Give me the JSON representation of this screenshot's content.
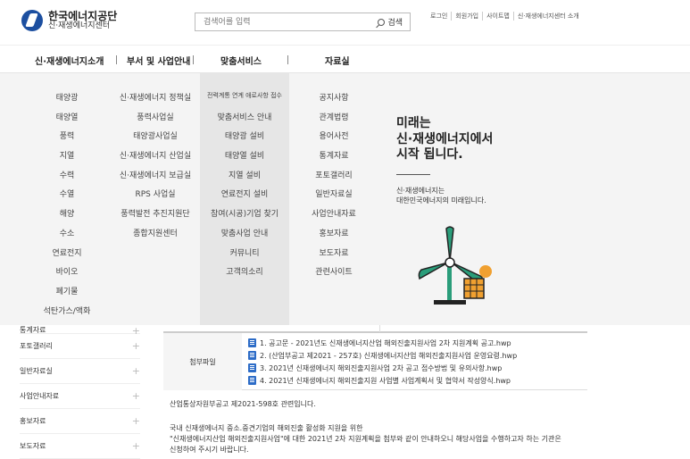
{
  "header": {
    "logo_name": "한국에너지공단",
    "logo_sub": "신·재생에너지센터",
    "search_placeholder": "검색어를 입력",
    "search_button": "검색",
    "util_links": [
      "로그인",
      "회원가입",
      "사이트맵",
      "신·재생에너지센터 소개"
    ]
  },
  "gnb": [
    "신·재생에너지소개",
    "부서 및 사업안내",
    "맞춤서비스",
    "자료실"
  ],
  "mega": {
    "col1": [
      "태양광",
      "태양열",
      "풍력",
      "지열",
      "수력",
      "수열",
      "해양",
      "수소",
      "연료전지",
      "바이오",
      "폐기물",
      "석탄가스/액화"
    ],
    "col2": [
      "신·재생에너지 정책실",
      "풍력사업실",
      "태양광사업실",
      "신·재생에너지 산업실",
      "신·재생에너지 보급실",
      "RPS 사업실",
      "풍력발전 추진지원단",
      "종합지원센터"
    ],
    "col3": [
      "전력계통 연계 애로사항 접수",
      "맞춤서비스 안내",
      "태양광 설비",
      "태양열 설비",
      "지열 설비",
      "연료전지 설비",
      "참여(시공)기업 찾기",
      "맞춤사업 안내",
      "커뮤니티",
      "고객의소리"
    ],
    "col4": [
      "공지사항",
      "관계법령",
      "용어사전",
      "통계자료",
      "포토갤러리",
      "일반자료실",
      "사업안내자료",
      "홍보자료",
      "보도자료",
      "관련사이트"
    ]
  },
  "promo": {
    "title1": "미래는",
    "title2": "신·재생에너지에서",
    "title3": "시작 됩니다.",
    "sub1": "신·재생에너지는",
    "sub2": "대한민국에너지의 미래입니다."
  },
  "lnb": [
    "통계자료",
    "포토갤러리",
    "일반자료실",
    "사업안내자료",
    "홍보자료",
    "보도자료"
  ],
  "attach": {
    "label": "첨부파일",
    "files": [
      "1. 공고문 - 2021년도 신재생에너지산업 해외진출지원사업 2차 지원계획 공고.hwp",
      "2. (산업부공고 제2021 - 257호) 신재생에너지산업 해외진출지원사업 운영요령.hwp",
      "3. 2021년 신재생에너지 해외진출지원사업 2차 공고 접수방법 및 유의사항.hwp",
      "4. 2021년 신재생에너지 해외진출지원 사업별 사업계획서 및 협약서 작성양식.hwp"
    ]
  },
  "content": {
    "ref": "산업통상자원부공고 제2021-598호 관련입니다.",
    "line1": "국내 신재생에너지 중소.중견기업의 해외진출 활성화 지원을 위한",
    "line2": "\"신재생에너지산업 해외진출지원사업\"에 대한 2021년 2차 지원계획을 첨부와 같이 안내하오니 해당사업을 수행하고자 하는 기관은",
    "line3": "신청하여 주시기 바랍니다."
  },
  "colors": {
    "brand": "#1c4fa0",
    "windmill": "#2a9d7a",
    "sun": "#f0a030"
  }
}
